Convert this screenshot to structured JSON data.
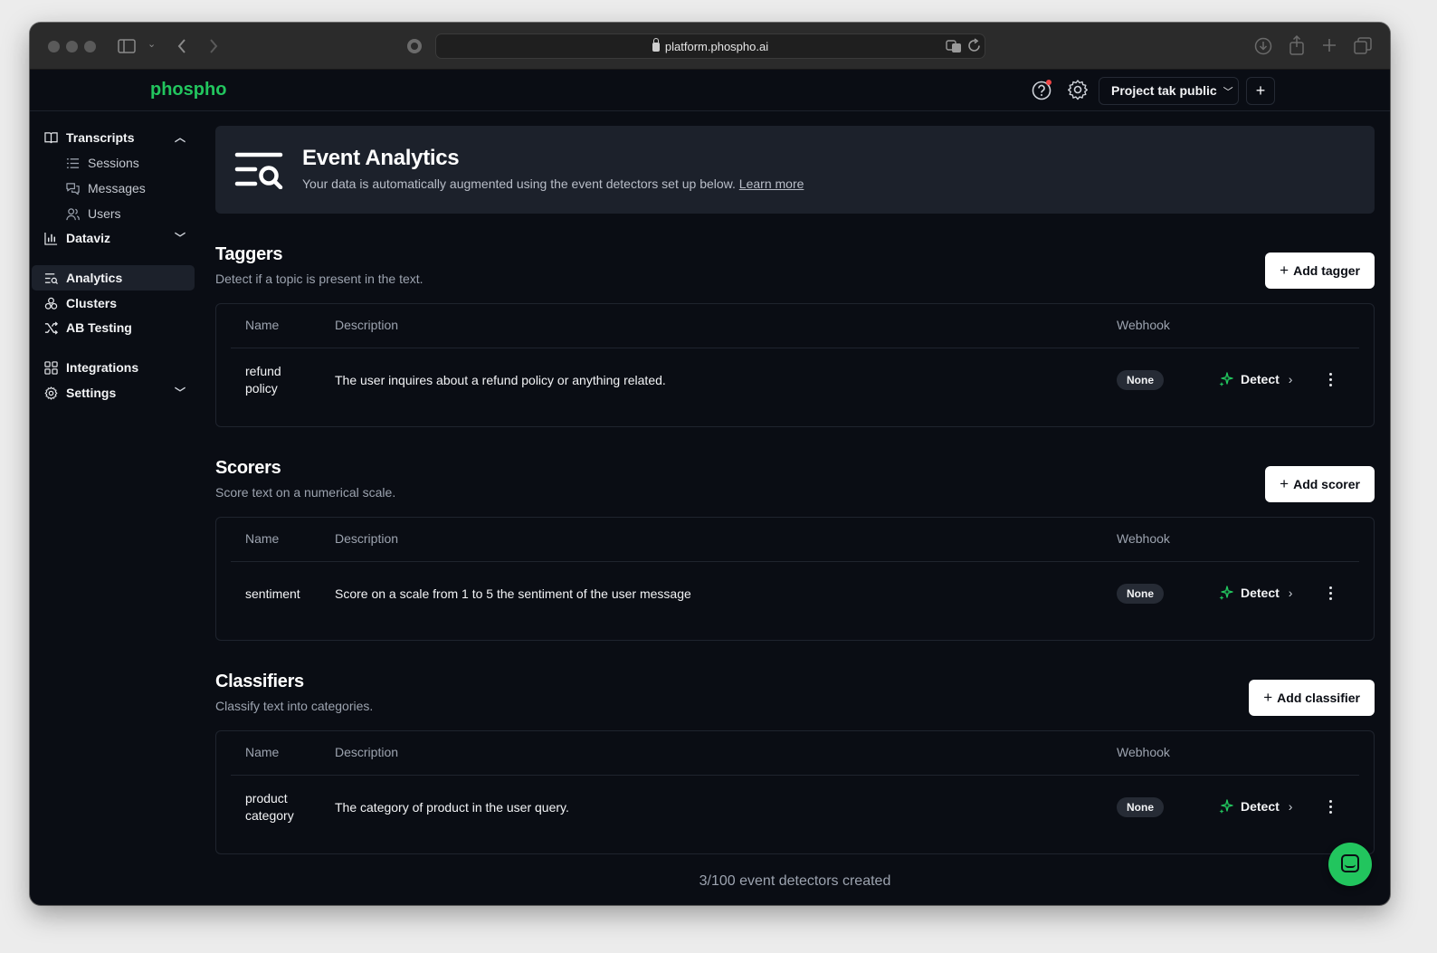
{
  "browser": {
    "url": "platform.phospho.ai"
  },
  "header": {
    "logo": "phospho",
    "project": "Project tak public",
    "plus": "+"
  },
  "sidebar": {
    "items": [
      {
        "label": "Transcripts",
        "icon": "transcripts-icon",
        "chevron": "up"
      },
      {
        "label": "Sessions",
        "icon": "list-icon"
      },
      {
        "label": "Messages",
        "icon": "messages-icon"
      },
      {
        "label": "Users",
        "icon": "users-icon"
      },
      {
        "label": "Dataviz",
        "icon": "chart-icon",
        "chevron": "down"
      },
      {
        "label": "Analytics",
        "icon": "analytics-icon",
        "active": true
      },
      {
        "label": "Clusters",
        "icon": "clusters-icon"
      },
      {
        "label": "AB Testing",
        "icon": "shuffle-icon"
      },
      {
        "label": "Integrations",
        "icon": "grid-icon"
      },
      {
        "label": "Settings",
        "icon": "gear-icon",
        "chevron": "down"
      }
    ]
  },
  "banner": {
    "title": "Event Analytics",
    "subtitle": "Your data is automatically augmented using the event detectors set up below.",
    "link": "Learn more"
  },
  "columns": {
    "name": "Name",
    "description": "Description",
    "webhook": "Webhook"
  },
  "sections": [
    {
      "title": "Taggers",
      "subtitle": "Detect if a topic is present in the text.",
      "add_label": "Add tagger",
      "row": {
        "name": "refund policy",
        "description": "The user inquires about a refund policy or anything related.",
        "webhook": "None",
        "action": "Detect"
      }
    },
    {
      "title": "Scorers",
      "subtitle": "Score text on a numerical scale.",
      "add_label": "Add scorer",
      "row": {
        "name": "sentiment",
        "description": "Score on a scale from 1 to 5 the sentiment of the user message",
        "webhook": "None",
        "action": "Detect"
      }
    },
    {
      "title": "Classifiers",
      "subtitle": "Classify text into categories.",
      "add_label": "Add classifier",
      "row": {
        "name": "product category",
        "description": "The category of product in the user query.",
        "webhook": "None",
        "action": "Detect"
      }
    }
  ],
  "footer": {
    "count": "3/100 event detectors created"
  },
  "colors": {
    "accent": "#22c55e",
    "background": "#0a0d14",
    "card": "#1c212b"
  }
}
